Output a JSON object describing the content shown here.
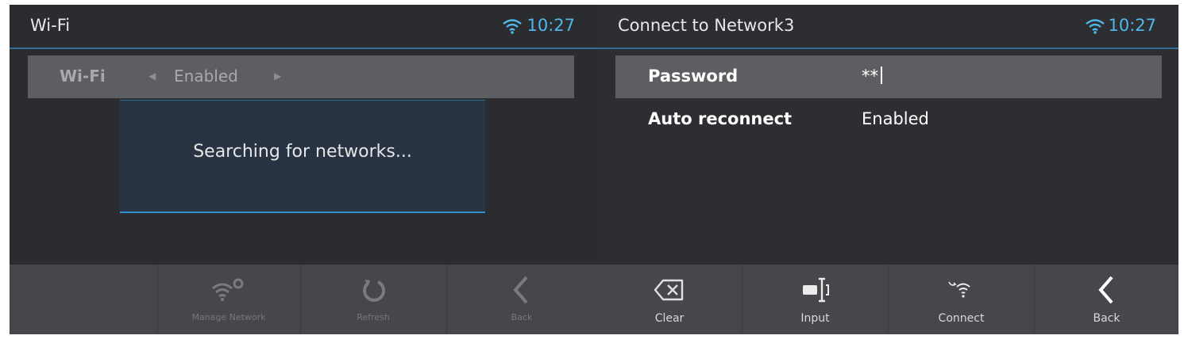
{
  "left": {
    "title": "Wi-Fi",
    "clock": "10:27",
    "wifi_row": {
      "label": "Wi-Fi",
      "value": "Enabled",
      "prev_arrow": "◀",
      "next_arrow": "▶"
    },
    "dialog": {
      "message": "Searching for networks..."
    },
    "toolbar": [
      {
        "label": "Manage Network",
        "icon": "manage-network-icon"
      },
      {
        "label": "Refresh",
        "icon": "refresh-icon"
      },
      {
        "label": "Back",
        "icon": "back-icon"
      }
    ]
  },
  "right": {
    "title": "Connect to Network3",
    "clock": "10:27",
    "fields": [
      {
        "label": "Password",
        "value": "**"
      },
      {
        "label": "Auto reconnect",
        "value": "Enabled"
      }
    ],
    "toolbar": [
      {
        "label": "Clear",
        "icon": "backspace-icon"
      },
      {
        "label": "Input",
        "icon": "keyboard-input-icon"
      },
      {
        "label": "Connect",
        "icon": "connect-wifi-icon"
      },
      {
        "label": "Back",
        "icon": "back-icon"
      }
    ]
  },
  "colors": {
    "accent": "#4fb7ea",
    "panel": "#2b2c2f",
    "selected_row": "#5d5e61",
    "toolbar": "#46474a",
    "dialog": "#283444"
  }
}
